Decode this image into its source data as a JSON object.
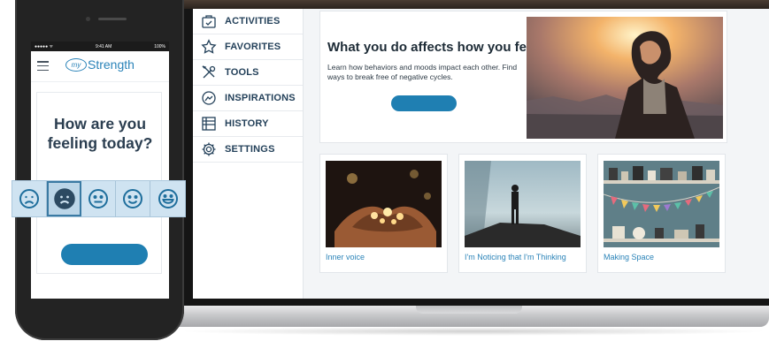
{
  "sidebar": {
    "items": [
      {
        "label": "ACTIVITIES",
        "icon": "activities-icon"
      },
      {
        "label": "FAVORITES",
        "icon": "star-icon"
      },
      {
        "label": "TOOLS",
        "icon": "tools-icon"
      },
      {
        "label": "INSPIRATIONS",
        "icon": "inspirations-icon"
      },
      {
        "label": "HISTORY",
        "icon": "history-icon"
      },
      {
        "label": "SETTINGS",
        "icon": "gear-icon"
      }
    ]
  },
  "hero": {
    "title": "What you do affects how you feel",
    "subtitle": "Learn how behaviors and moods impact each other. Find ways to break free of negative cycles."
  },
  "tiles": [
    {
      "caption": "Inner voice",
      "image": "hands-holding-lights"
    },
    {
      "caption": "I'm Noticing that I'm Thinking",
      "image": "person-on-cliff"
    },
    {
      "caption": "Making Space",
      "image": "shelves-with-bunting"
    }
  ],
  "phone": {
    "status": {
      "carrier": "●●●●● ᯤ",
      "time": "9:41 AM",
      "battery": "100%"
    },
    "logo": {
      "mark": "my",
      "text": "Strength"
    },
    "question_line1": "How are you",
    "question_line2": "feeling today?",
    "moods": [
      "very-sad-icon",
      "sad-icon",
      "neutral-icon",
      "happy-icon",
      "very-happy-icon"
    ],
    "selected_mood_index": 1
  },
  "colors": {
    "accent": "#1f7fb2",
    "link": "#2a83b8",
    "sidebar_text": "#24415a",
    "mood_strip": "#cfe3f1"
  }
}
